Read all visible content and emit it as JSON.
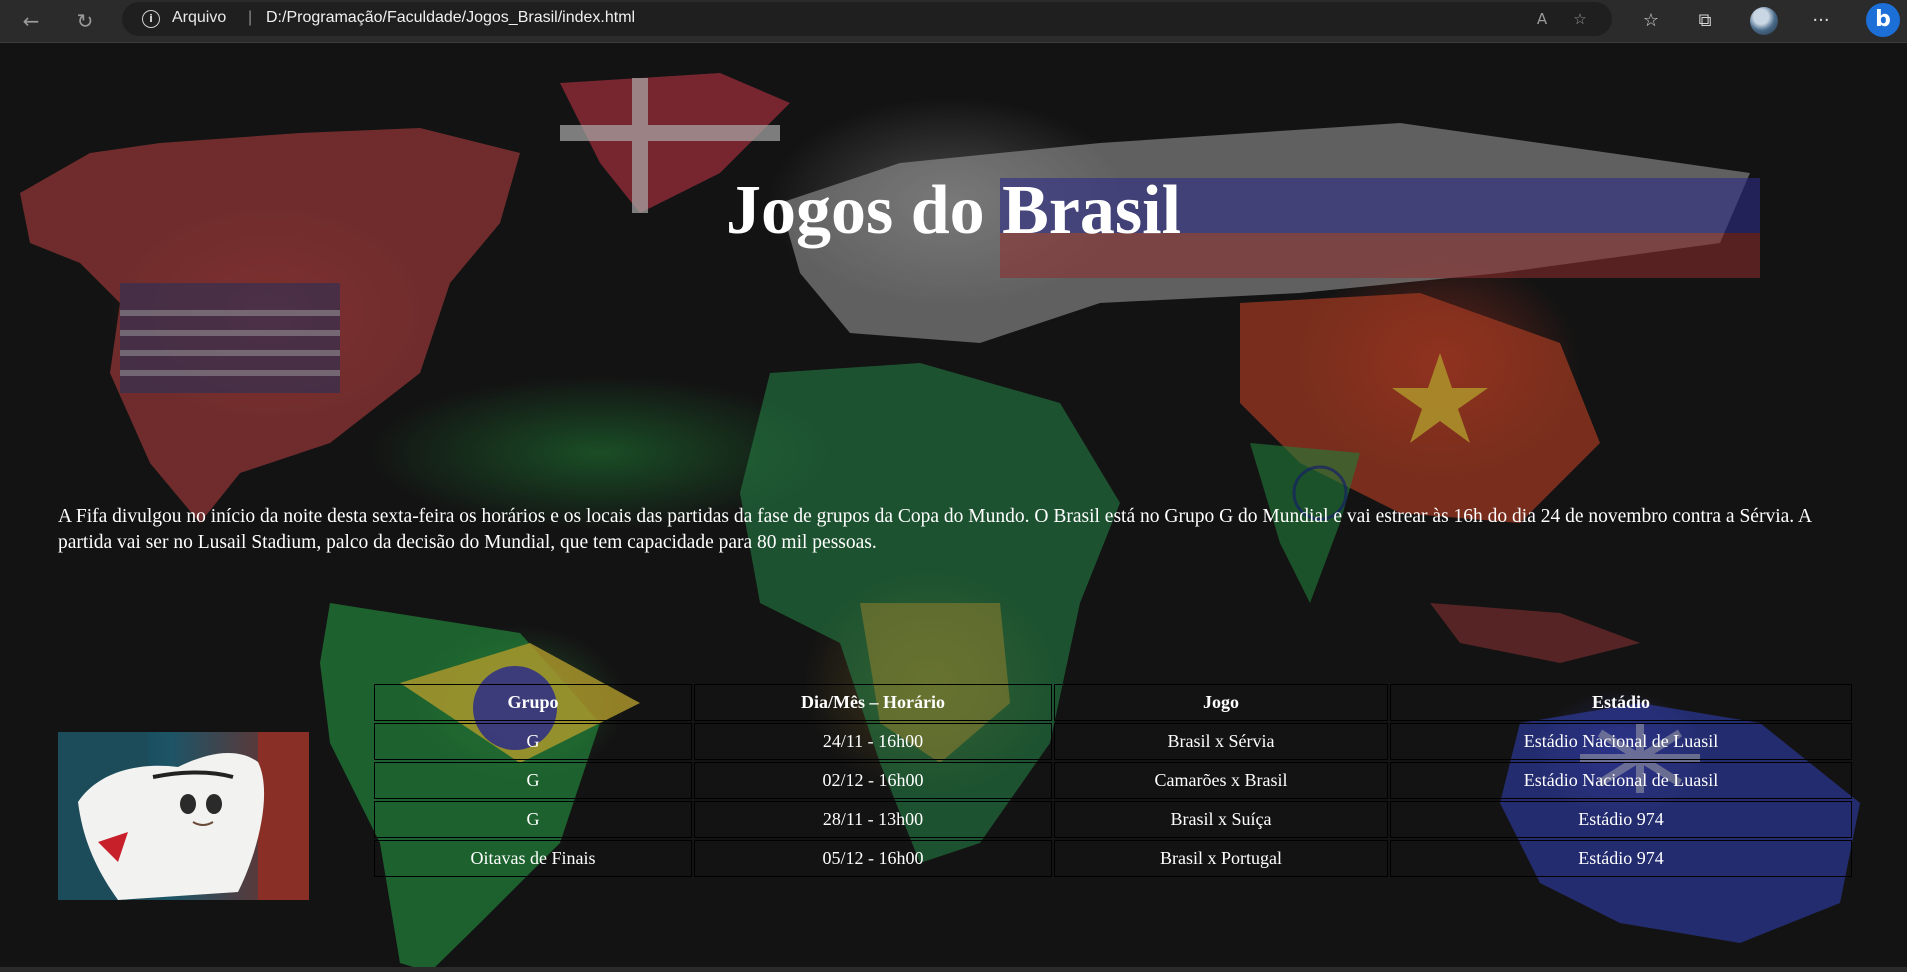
{
  "browser": {
    "scheme_label": "Arquivo",
    "separator": "|",
    "url": "D:/Programação/Faculdade/Jogos_Brasil/index.html",
    "icons": [
      "back-arrow-icon",
      "refresh-icon",
      "info-icon",
      "read-aloud-icon",
      "add-favorite-icon",
      "favorites-icon",
      "collections-icon",
      "profile-avatar",
      "more-icon",
      "bing-icon"
    ],
    "read_aloud_glyph": "A",
    "more_glyph": "···",
    "bing_glyph": "b"
  },
  "page": {
    "title": "Jogos do Brasil",
    "intro": "A Fifa divulgou no início da noite desta sexta-feira os horários e os locais das partidas da fase de grupos da Copa do Mundo. O Brasil está no Grupo G do Mundial e vai estrear às 16h do dia 24 de novembro contra a Sérvia. A partida vai ser no Lusail Stadium, palco da decisão do Mundial, que tem capacidade para 80 mil pessoas.",
    "image": "mascot-photo"
  },
  "table": {
    "headers": [
      "Grupo",
      "Dia/Mês – Horário",
      "Jogo",
      "Estádio"
    ],
    "rows": [
      [
        "G",
        "24/11 - 16h00",
        "Brasil x Sérvia",
        "Estádio Nacional de Luasil"
      ],
      [
        "G",
        "02/12 - 16h00",
        "Camarões x Brasil",
        "Estádio Nacional de Luasil"
      ],
      [
        "G",
        "28/11 - 13h00",
        "Brasil x Suíça",
        "Estádio 974"
      ],
      [
        "Oitavas de Finais",
        "05/12 - 16h00",
        "Brasil x Portugal",
        "Estádio 974"
      ]
    ]
  }
}
